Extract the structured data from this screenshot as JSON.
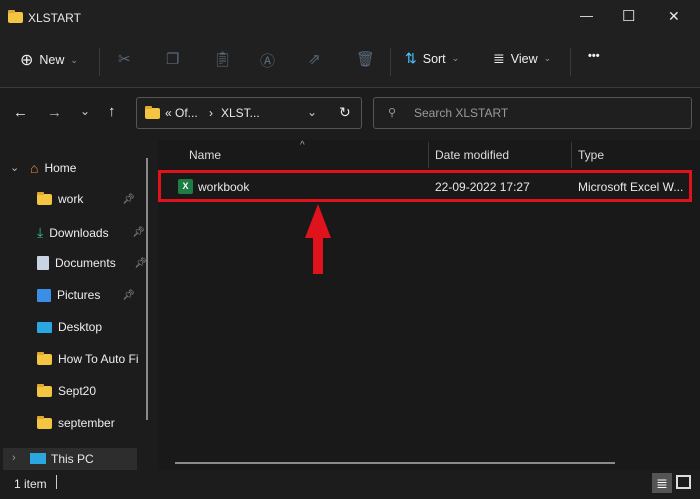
{
  "window": {
    "title": "XLSTART",
    "minimize": "—",
    "maximize": "☐",
    "close": "✕"
  },
  "toolbar": {
    "new_label": "New",
    "sort_label": "Sort",
    "view_label": "View",
    "more": "•••"
  },
  "address": {
    "crumb1": "« Of...",
    "crumb_sep": "›",
    "crumb2": "XLST...",
    "search_placeholder": "Search XLSTART"
  },
  "sidebar": {
    "home": "Home",
    "items": [
      {
        "label": "work",
        "pinned": true
      },
      {
        "label": "Downloads",
        "pinned": true
      },
      {
        "label": "Documents",
        "pinned": true
      },
      {
        "label": "Pictures",
        "pinned": true
      },
      {
        "label": "Desktop"
      },
      {
        "label": "How To Auto Fi"
      },
      {
        "label": "Sept20"
      },
      {
        "label": "september"
      }
    ],
    "this_pc": "This PC"
  },
  "columns": {
    "name": "Name",
    "date": "Date modified",
    "type": "Type"
  },
  "files": [
    {
      "name": "workbook",
      "date": "22-09-2022 17:27",
      "type": "Microsoft Excel W..."
    }
  ],
  "status": {
    "count": "1 item"
  },
  "colors": {
    "highlight": "#e0121b",
    "accent": "#4cc2ff"
  }
}
